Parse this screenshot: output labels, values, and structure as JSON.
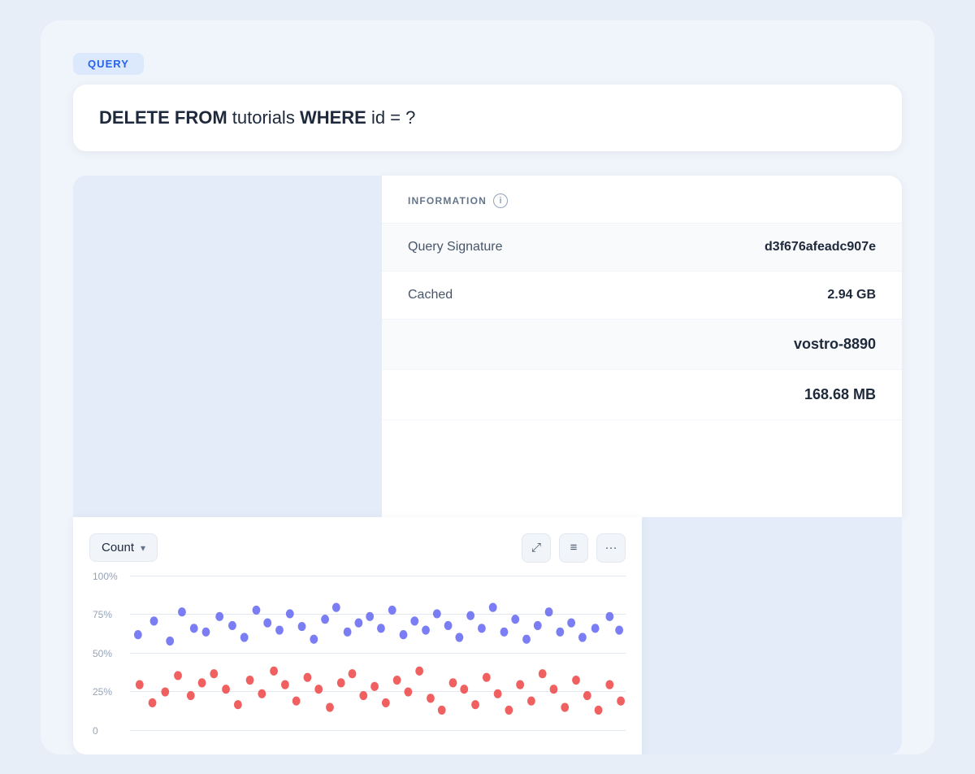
{
  "query": {
    "label": "QUERY",
    "sql": {
      "part1_kw": "DELETE FROM",
      "part1_normal": " tutorials ",
      "part2_kw": "WHERE",
      "part2_normal": " id = ?"
    }
  },
  "information": {
    "header_label": "INFORMATION",
    "info_icon": "i",
    "rows": [
      {
        "label": "Query Signature",
        "value": "d3f676afeadc907e"
      },
      {
        "label": "Cached",
        "value": "2.94 GB"
      }
    ],
    "extra_rows": [
      {
        "value": "vostro-8890"
      },
      {
        "value": "168.68 MB"
      }
    ]
  },
  "chart": {
    "dropdown_label": "Count",
    "dropdown_chevron": "▾",
    "expand_icon": "⤢",
    "filter_icon": "≡",
    "more_icon": "•••",
    "y_labels": [
      "100%",
      "75%",
      "50%",
      "25%",
      "0"
    ],
    "colors": {
      "blue": "#6366f1",
      "red": "#ef4444"
    }
  },
  "colors": {
    "accent_blue": "#2563eb",
    "query_bg": "#dce8fb",
    "panel_bg": "#e4ecf9"
  }
}
